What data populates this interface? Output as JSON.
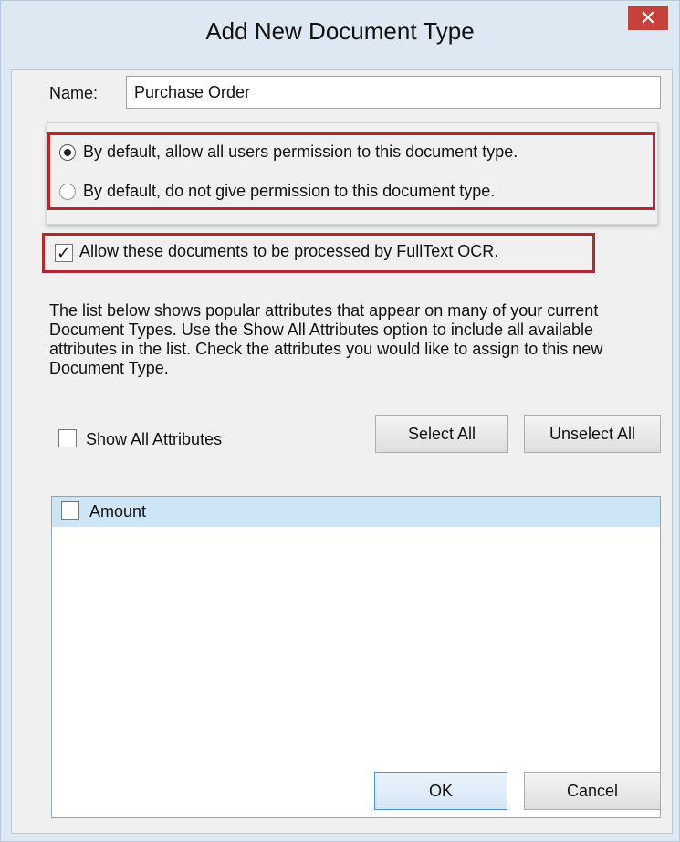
{
  "window": {
    "title": "Add New Document Type",
    "close_glyph": "✕"
  },
  "name_field": {
    "label": "Name:",
    "value": "Purchase Order"
  },
  "permissions": {
    "options": [
      {
        "label": "By default, allow all users permission to this document type.",
        "selected": true
      },
      {
        "label": "By default, do not give permission to this document type.",
        "selected": false
      }
    ]
  },
  "ocr": {
    "label": "Allow these documents to be processed by FullText OCR.",
    "checked": true
  },
  "description": "The list below shows popular attributes that appear on many of your current Document Types.  Use the Show All Attributes option to include all available attributes in the list.  Check the attributes you would like to assign to this new Document Type.",
  "show_all": {
    "label": "Show All Attributes",
    "checked": false
  },
  "buttons": {
    "select_all": "Select All",
    "unselect_all": "Unselect All",
    "ok": "OK",
    "cancel": "Cancel"
  },
  "attributes": [
    {
      "label": "Amount",
      "checked": false
    }
  ],
  "colors": {
    "highlight": "#b3282e",
    "close_button": "#c7413b",
    "selection": "#cde5f7"
  },
  "icons": {
    "close": "close-icon",
    "check": "checkmark-icon"
  }
}
